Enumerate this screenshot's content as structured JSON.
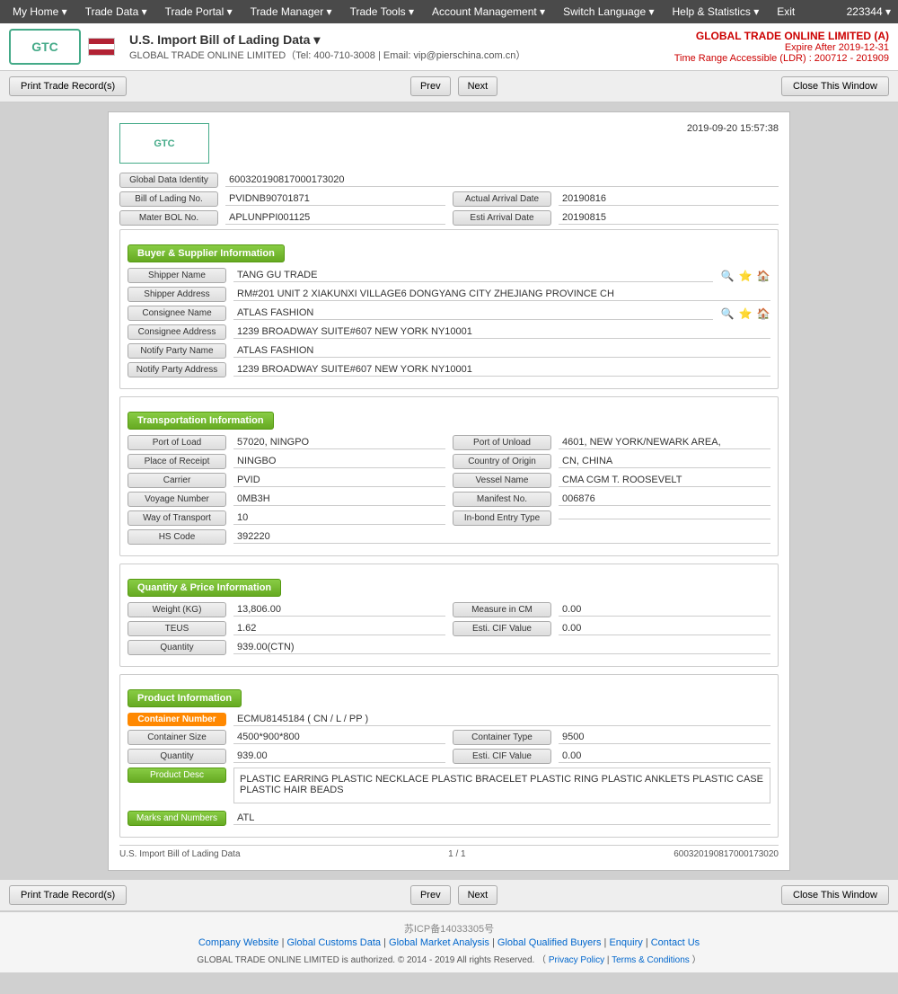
{
  "nav": {
    "items": [
      {
        "label": "My Home ▾"
      },
      {
        "label": "Trade Data ▾"
      },
      {
        "label": "Trade Portal ▾"
      },
      {
        "label": "Trade Manager ▾"
      },
      {
        "label": "Trade Tools ▾"
      },
      {
        "label": "Account Management ▾"
      },
      {
        "label": "Switch Language ▾"
      },
      {
        "label": "Help & Statistics ▾"
      },
      {
        "label": "Exit"
      }
    ],
    "user_id": "223344 ▾"
  },
  "header": {
    "logo_text": "GTC",
    "title": "U.S. Import Bill of Lading Data ▾",
    "subtitle": "GLOBAL TRADE ONLINE LIMITED（Tel: 400-710-3008 | Email: vip@pierschina.com.cn）",
    "company_name": "GLOBAL TRADE ONLINE LIMITED (A)",
    "expire": "Expire After 2019-12-31",
    "time_range": "Time Range Accessible (LDR) : 200712 - 201909"
  },
  "toolbar": {
    "print_label": "Print Trade Record(s)",
    "prev_label": "Prev",
    "next_label": "Next",
    "close_label": "Close This Window"
  },
  "document": {
    "timestamp": "2019-09-20 15:57:38",
    "global_data_identity": "600320190817000173020",
    "bill_of_lading_no": "PVIDNB90701871",
    "actual_arrival_date": "20190816",
    "mater_bol_no": "APLUNPPI001125",
    "esti_arrival_date": "20190815",
    "buyer_supplier": {
      "section_title": "Buyer & Supplier Information",
      "shipper_name": "TANG GU TRADE",
      "shipper_address": "RM#201 UNIT 2 XIAKUNXI VILLAGE6 DONGYANG CITY ZHEJIANG PROVINCE CH",
      "consignee_name": "ATLAS FASHION",
      "consignee_address": "1239 BROADWAY SUITE#607 NEW YORK NY10001",
      "notify_party_name": "ATLAS FASHION",
      "notify_party_address": "1239 BROADWAY SUITE#607 NEW YORK NY10001"
    },
    "transportation": {
      "section_title": "Transportation Information",
      "port_of_load": "57020, NINGPO",
      "port_of_unload": "4601, NEW YORK/NEWARK AREA,",
      "place_of_receipt": "NINGBO",
      "country_of_origin": "CN, CHINA",
      "carrier": "PVID",
      "vessel_name": "CMA CGM T. ROOSEVELT",
      "voyage_number": "0MB3H",
      "manifest_no": "006876",
      "way_of_transport": "10",
      "in_bond_entry_type": "",
      "hs_code": "392220"
    },
    "quantity_price": {
      "section_title": "Quantity & Price Information",
      "weight_kg": "13,806.00",
      "measure_in_cm": "0.00",
      "teus": "1.62",
      "esti_cif_value": "0.00",
      "quantity": "939.00(CTN)"
    },
    "product": {
      "section_title": "Product Information",
      "container_number": "ECMU8145184 ( CN / L / PP )",
      "container_size": "4500*900*800",
      "container_type": "9500",
      "quantity": "939.00",
      "esti_cif_value": "0.00",
      "product_desc": "PLASTIC EARRING PLASTIC NECKLACE PLASTIC BRACELET PLASTIC RING PLASTIC ANKLETS PLASTIC CASE PLASTIC HAIR BEADS",
      "marks_and_numbers": "ATL"
    },
    "footer": {
      "record_type": "U.S. Import Bill of Lading Data",
      "page": "1 / 1",
      "record_id": "600320190817000173020"
    }
  },
  "page_footer": {
    "icp": "苏ICP备14033305号",
    "links": [
      {
        "label": "Company Website"
      },
      {
        "label": "Global Customs Data"
      },
      {
        "label": "Global Market Analysis"
      },
      {
        "label": "Global Qualified Buyers"
      },
      {
        "label": "Enquiry"
      },
      {
        "label": "Contact Us"
      }
    ],
    "copyright": "GLOBAL TRADE ONLINE LIMITED is authorized. © 2014 - 2019 All rights Reserved.  （",
    "privacy_policy": "Privacy Policy",
    "separator": " | ",
    "terms": "Terms & Conditions",
    "end_paren": "）"
  },
  "labels": {
    "global_data_identity": "Global Data Identity",
    "bill_of_lading_no": "Bill of Lading No.",
    "actual_arrival_date": "Actual Arrival Date",
    "mater_bol_no": "Mater BOL No.",
    "esti_arrival_date": "Esti Arrival Date",
    "shipper_name": "Shipper Name",
    "shipper_address": "Shipper Address",
    "consignee_name": "Consignee Name",
    "consignee_address": "Consignee Address",
    "notify_party_name": "Notify Party Name",
    "notify_party_address": "Notify Party Address",
    "port_of_load": "Port of Load",
    "port_of_unload": "Port of Unload",
    "place_of_receipt": "Place of Receipt",
    "country_of_origin": "Country of Origin",
    "carrier": "Carrier",
    "vessel_name": "Vessel Name",
    "voyage_number": "Voyage Number",
    "manifest_no": "Manifest No.",
    "way_of_transport": "Way of Transport",
    "in_bond_entry_type": "In-bond Entry Type",
    "hs_code": "HS Code",
    "weight_kg": "Weight (KG)",
    "measure_in_cm": "Measure in CM",
    "teus": "TEUS",
    "esti_cif_value": "Esti. CIF Value",
    "quantity": "Quantity",
    "container_number": "Container Number",
    "container_size": "Container Size",
    "container_type": "Container Type",
    "product_desc": "Product Desc",
    "marks_and_numbers": "Marks and Numbers"
  }
}
